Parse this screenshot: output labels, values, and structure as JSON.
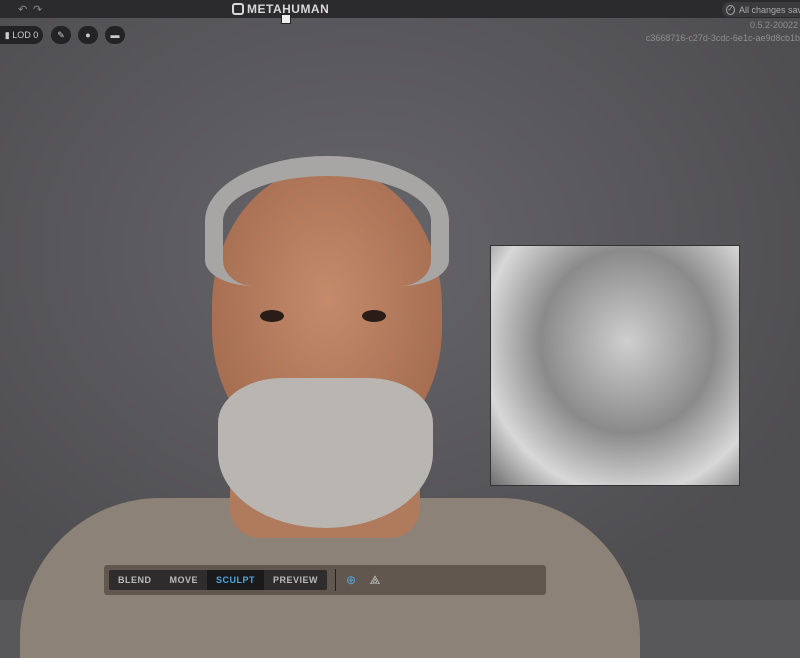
{
  "header": {
    "brand": "METAHUMAN",
    "save_status": "All changes saved"
  },
  "viewport_toolbar": {
    "lod_label": "LOD 0"
  },
  "version": {
    "build": "0.5.2-20022",
    "guid": "c3668716-c27d-3cdc-6e1c-ae9d8cb1b"
  },
  "modes": {
    "items": [
      {
        "label": "BLEND"
      },
      {
        "label": "MOVE"
      },
      {
        "label": "SCULPT",
        "active": true
      },
      {
        "label": "PREVIEW"
      }
    ]
  },
  "colors": {
    "accent": "#4ea6dc"
  }
}
